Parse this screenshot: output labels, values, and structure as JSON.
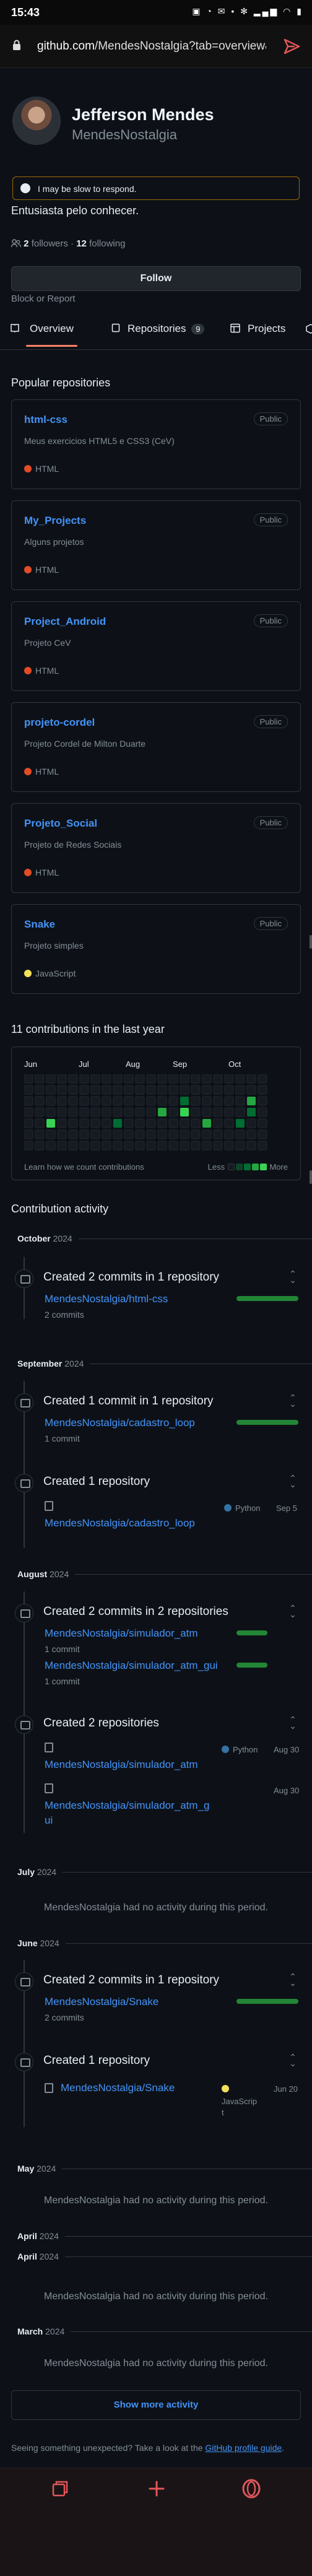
{
  "status_bar": {
    "time": "15:43",
    "icons": "▣ ◔ ✉ • ✻ ▂▄▆ ◠ ▮"
  },
  "browser": {
    "url_host": "github.com",
    "url_rest": "/MendesNostalgia?tab=overview&..."
  },
  "profile": {
    "name": "Jefferson Mendes",
    "login": "MendesNostalgia",
    "status": "I may be slow to respond.",
    "bio": "Entusiasta pelo conhecer.",
    "followers": "2",
    "followers_label": "followers",
    "separator": "·",
    "following": "12",
    "following_label": "following",
    "follow_button": "Follow",
    "block_report": "Block or Report"
  },
  "tabs": [
    {
      "label": "Overview"
    },
    {
      "label": "Repositories",
      "count": "9"
    },
    {
      "label": "Projects"
    }
  ],
  "popular": {
    "title": "Popular repositories",
    "repos": [
      {
        "name": "html-css",
        "visibility": "Public",
        "description": "Meus exercicios HTML5 e CSS3 (CeV)",
        "language": "HTML",
        "lang_color": "#e34c26"
      },
      {
        "name": "My_Projects",
        "visibility": "Public",
        "description": "Alguns projetos",
        "language": "HTML",
        "lang_color": "#e34c26"
      },
      {
        "name": "Project_Android",
        "visibility": "Public",
        "description": "Projeto CeV",
        "language": "HTML",
        "lang_color": "#e34c26"
      },
      {
        "name": "projeto-cordel",
        "visibility": "Public",
        "description": "Projeto Cordel de Milton Duarte",
        "language": "HTML",
        "lang_color": "#e34c26"
      },
      {
        "name": "Projeto_Social",
        "visibility": "Public",
        "description": "Projeto de Redes Sociais",
        "language": "HTML",
        "lang_color": "#e34c26"
      },
      {
        "name": "Snake",
        "visibility": "Public",
        "description": "Projeto simples",
        "language": "JavaScript",
        "lang_color": "#f1e05a"
      }
    ]
  },
  "contributions": {
    "title": "11 contributions in the last year",
    "months": [
      "Jun",
      "Jul",
      "Aug",
      "Sep",
      "Oct"
    ],
    "learn": "Learn how we count contributions",
    "less": "Less",
    "more": "More"
  },
  "activity": {
    "title": "Contribution activity",
    "month_oct": "October",
    "year_oct": "2024",
    "oct_commits_title": "Created 2 commits in 1 repository",
    "oct_repo": "MendesNostalgia/html-css",
    "oct_count": "2 commits",
    "month_sep": "September",
    "year_sep": "2024",
    "sep_commits_title": "Created 1 commit in 1 repository",
    "sep_repo": "MendesNostalgia/cadastro_loop",
    "sep_count": "1 commit",
    "sep_created_title": "Created 1 repository",
    "sep_created_repo": "MendesNostalgia/cadastro_loop",
    "sep_created_lang": "Python",
    "sep_created_date": "Sep 5",
    "month_aug": "August",
    "year_aug": "2024",
    "aug_commits_title": "Created 2 commits in 2 repositories",
    "aug_repo1": "MendesNostalgia/simulador_atm",
    "aug_repo1_count": "1 commit",
    "aug_repo2": "MendesNostalgia/simulador_atm_gui",
    "aug_repo2_count": "1 commit",
    "aug_created_title": "Created 2 repositories",
    "aug_created_repo1": "MendesNostalgia/simulador_atm",
    "aug_created_repo1_lang": "Python",
    "aug_created_repo1_date": "Aug 30",
    "aug_created_repo2_line1": "MendesNostalgia/simulador_atm_g",
    "aug_created_repo2_line2": "ui",
    "aug_created_repo2_date": "Aug 30",
    "month_jul": "July",
    "year_jul": "2024",
    "jul_none": "MendesNostalgia had no activity during this period.",
    "month_jun": "June",
    "year_jun": "2024",
    "jun_commits_title": "Created 2 commits in 1 repository",
    "jun_repo": "MendesNostalgia/Snake",
    "jun_count": "2 commits",
    "jun_created_title": "Created 1 repository",
    "jun_created_repo": "MendesNostalgia/Snake",
    "jun_created_lang_line1": "JavaScrip",
    "jun_created_lang_line2": "t",
    "jun_created_date": "Jun 20",
    "month_may": "May",
    "year_may": "2024",
    "may_none": "MendesNostalgia had no activity during this period.",
    "month_apr1": "April",
    "year_apr1": "2024",
    "month_apr2": "April",
    "year_apr2": "2024",
    "apr_none": "MendesNostalgia had no activity during this period.",
    "month_mar": "March",
    "year_mar": "2024",
    "mar_none": "MendesNostalgia had no activity during this period.",
    "show_more": "Show more activity",
    "feedback_text": "Seeing something unexpected? Take a look at the",
    "feedback_link": "GitHub profile guide",
    "feedback_end": "."
  },
  "colors": {
    "link": "#4493f8",
    "accent": "#f78166",
    "green": "#238636",
    "html": "#e34c26",
    "python": "#3572A5",
    "js": "#f1e05a"
  }
}
